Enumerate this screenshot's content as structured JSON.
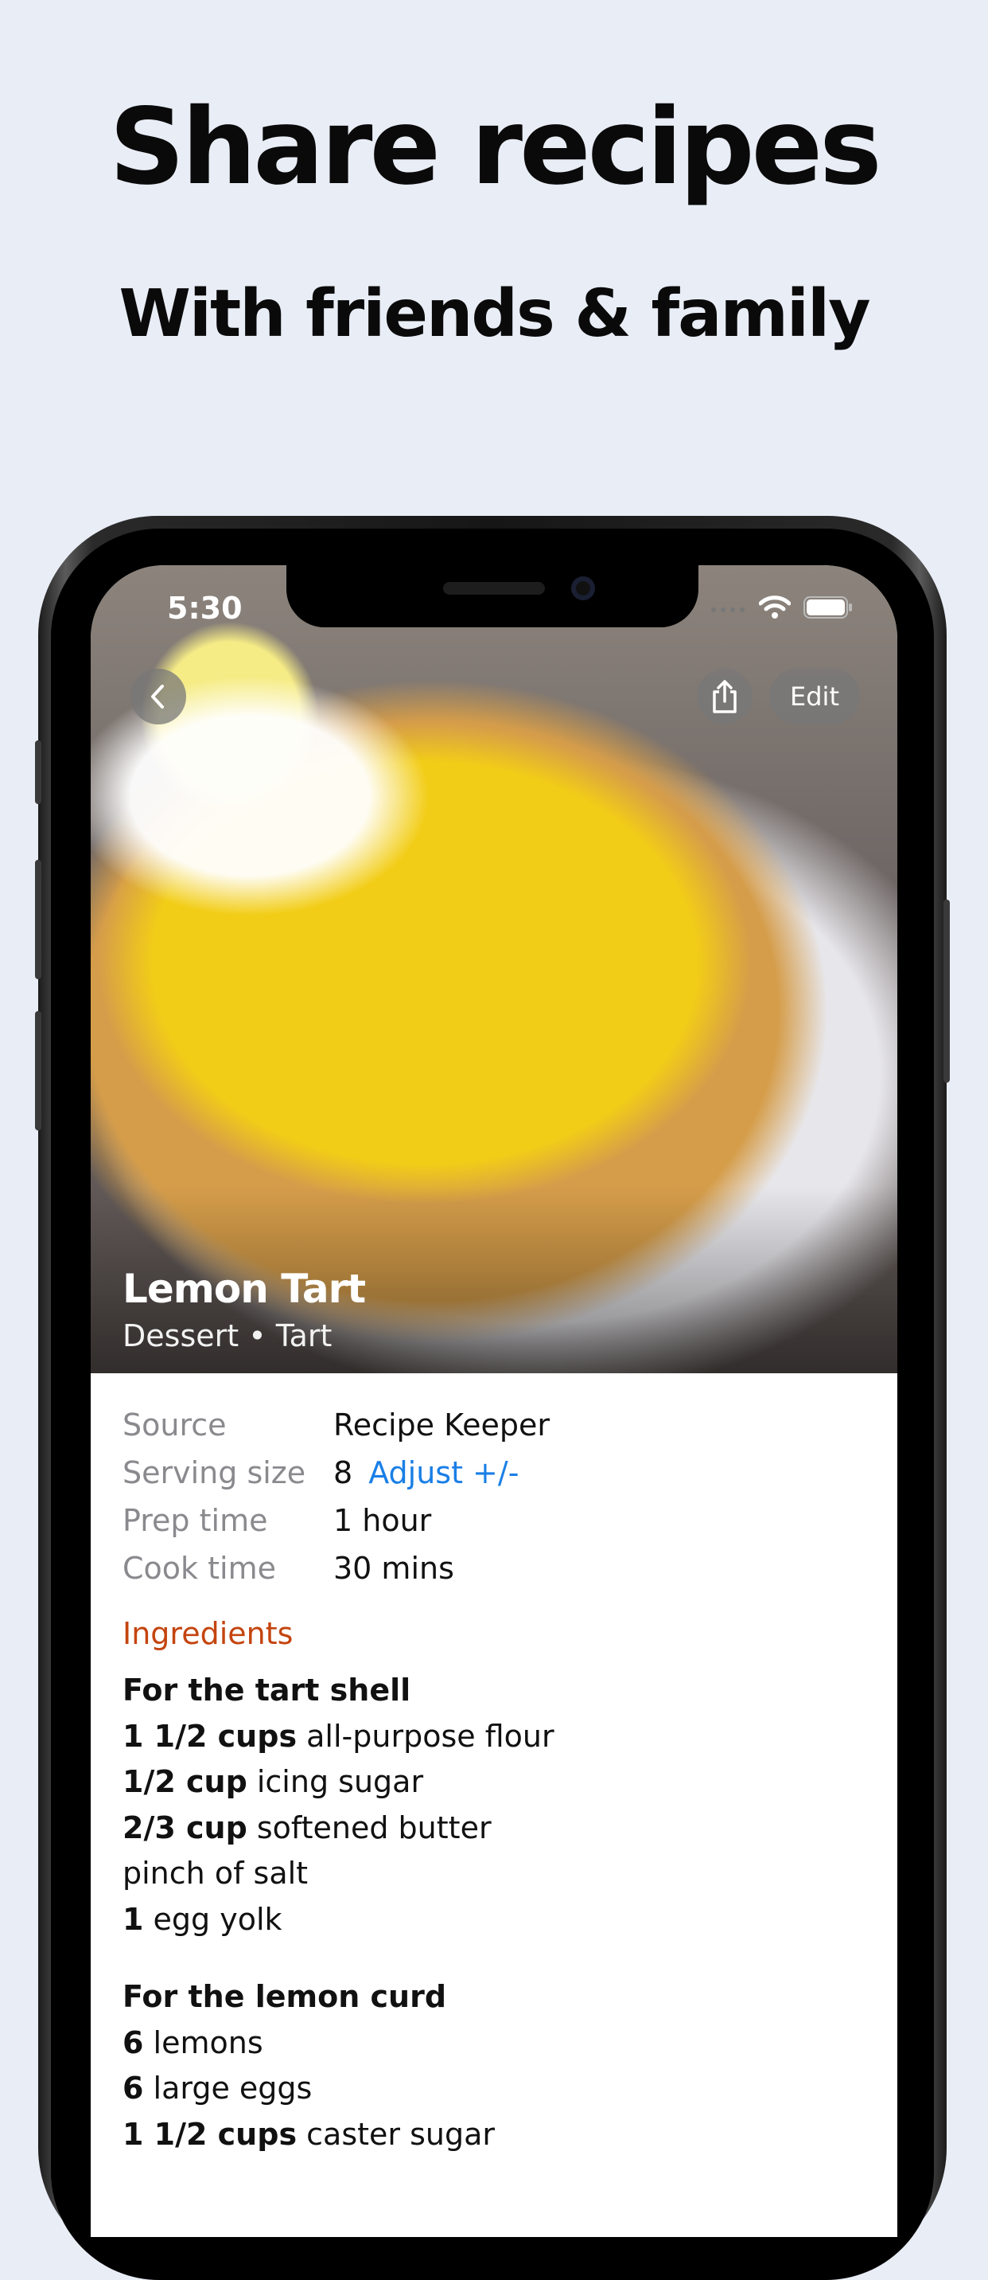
{
  "headline": "Share recipes",
  "subheadline": "With friends & family",
  "status_bar": {
    "time": "5:30",
    "icons": [
      "signal-icon",
      "wifi-icon",
      "battery-icon"
    ]
  },
  "nav": {
    "back_icon": "chevron-left-icon",
    "share_icon": "share-icon",
    "edit_label": "Edit"
  },
  "recipe": {
    "title": "Lemon Tart",
    "subtitle": "Dessert • Tart",
    "details": {
      "source_label": "Source",
      "source_value": "Recipe Keeper",
      "serving_label": "Serving size",
      "serving_value": "8",
      "adjust_label": "Adjust +/-",
      "prep_label": "Prep time",
      "prep_value": "1 hour",
      "cook_label": "Cook time",
      "cook_value": "30 mins"
    },
    "ingredients_title": "Ingredients",
    "groups": [
      {
        "name": "For the tart shell",
        "items": [
          {
            "qty": "1 1/2 cups",
            "text": " all-purpose flour"
          },
          {
            "qty": "1/2 cup",
            "text": " icing sugar"
          },
          {
            "qty": "2/3 cup",
            "text": " softened butter"
          },
          {
            "qty": "",
            "text": "pinch of salt"
          },
          {
            "qty": "1",
            "text": " egg yolk"
          }
        ]
      },
      {
        "name": "For the lemon curd",
        "items": [
          {
            "qty": "6",
            "text": " lemons"
          },
          {
            "qty": "6",
            "text": " large eggs"
          },
          {
            "qty": "1 1/2 cups",
            "text": " caster sugar"
          }
        ]
      }
    ]
  },
  "colors": {
    "background": "#e9edf6",
    "link": "#1a7fe6",
    "section": "#c4450f"
  }
}
